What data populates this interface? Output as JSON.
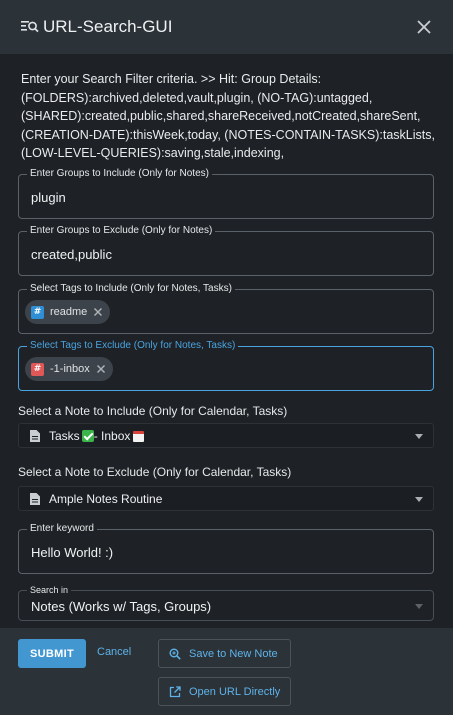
{
  "window": {
    "title": "URL-Search-GUI",
    "icon": "search-list-icon"
  },
  "hint": "Enter your Search Filter criteria. >> Hit: Group Details: (FOLDERS):archived,deleted,vault,plugin, (NO-TAG):untagged, (SHARED):created,public,shared,shareReceived,notCreated,shareSent, (CREATION-DATE):thisWeek,today, (NOTES-CONTAIN-TASKS):taskLists, (LOW-LEVEL-QUERIES):saving,stale,indexing,",
  "groups_include": {
    "label": "Enter Groups to Include (Only for Notes)",
    "value": "plugin"
  },
  "groups_exclude": {
    "label": "Enter Groups to Exclude (Only for Notes)",
    "value": "created,public"
  },
  "tags_include": {
    "label": "Select Tags to Include (Only for Notes, Tasks)",
    "chips": [
      {
        "label": "readme",
        "icon_color": "#2f8fd6"
      }
    ]
  },
  "tags_exclude": {
    "label": "Select Tags to Exclude (Only for Notes, Tasks)",
    "chips": [
      {
        "label": "-1-inbox",
        "icon_color": "#e05757"
      }
    ]
  },
  "note_include": {
    "label": "Select a Note to Include (Only for Calendar, Tasks)",
    "value_prefix": "Tasks",
    "value_middle": " - Inbox"
  },
  "note_exclude": {
    "label": "Select a Note to Exclude (Only for Calendar, Tasks)",
    "value": "Ample Notes Routine"
  },
  "keyword": {
    "label": "Enter keyword",
    "value": "Hello World! :)"
  },
  "search_in": {
    "label": "Search in",
    "value": "Notes (Works w/ Tags, Groups)"
  },
  "buttons": {
    "submit": "SUBMIT",
    "cancel": "Cancel",
    "save_new_note": "Save to New Note",
    "open_url": "Open URL Directly"
  },
  "colors": {
    "accent": "#4297d1",
    "focus": "#4aa3df",
    "background": "#1e2226",
    "bar": "#2b3238"
  }
}
